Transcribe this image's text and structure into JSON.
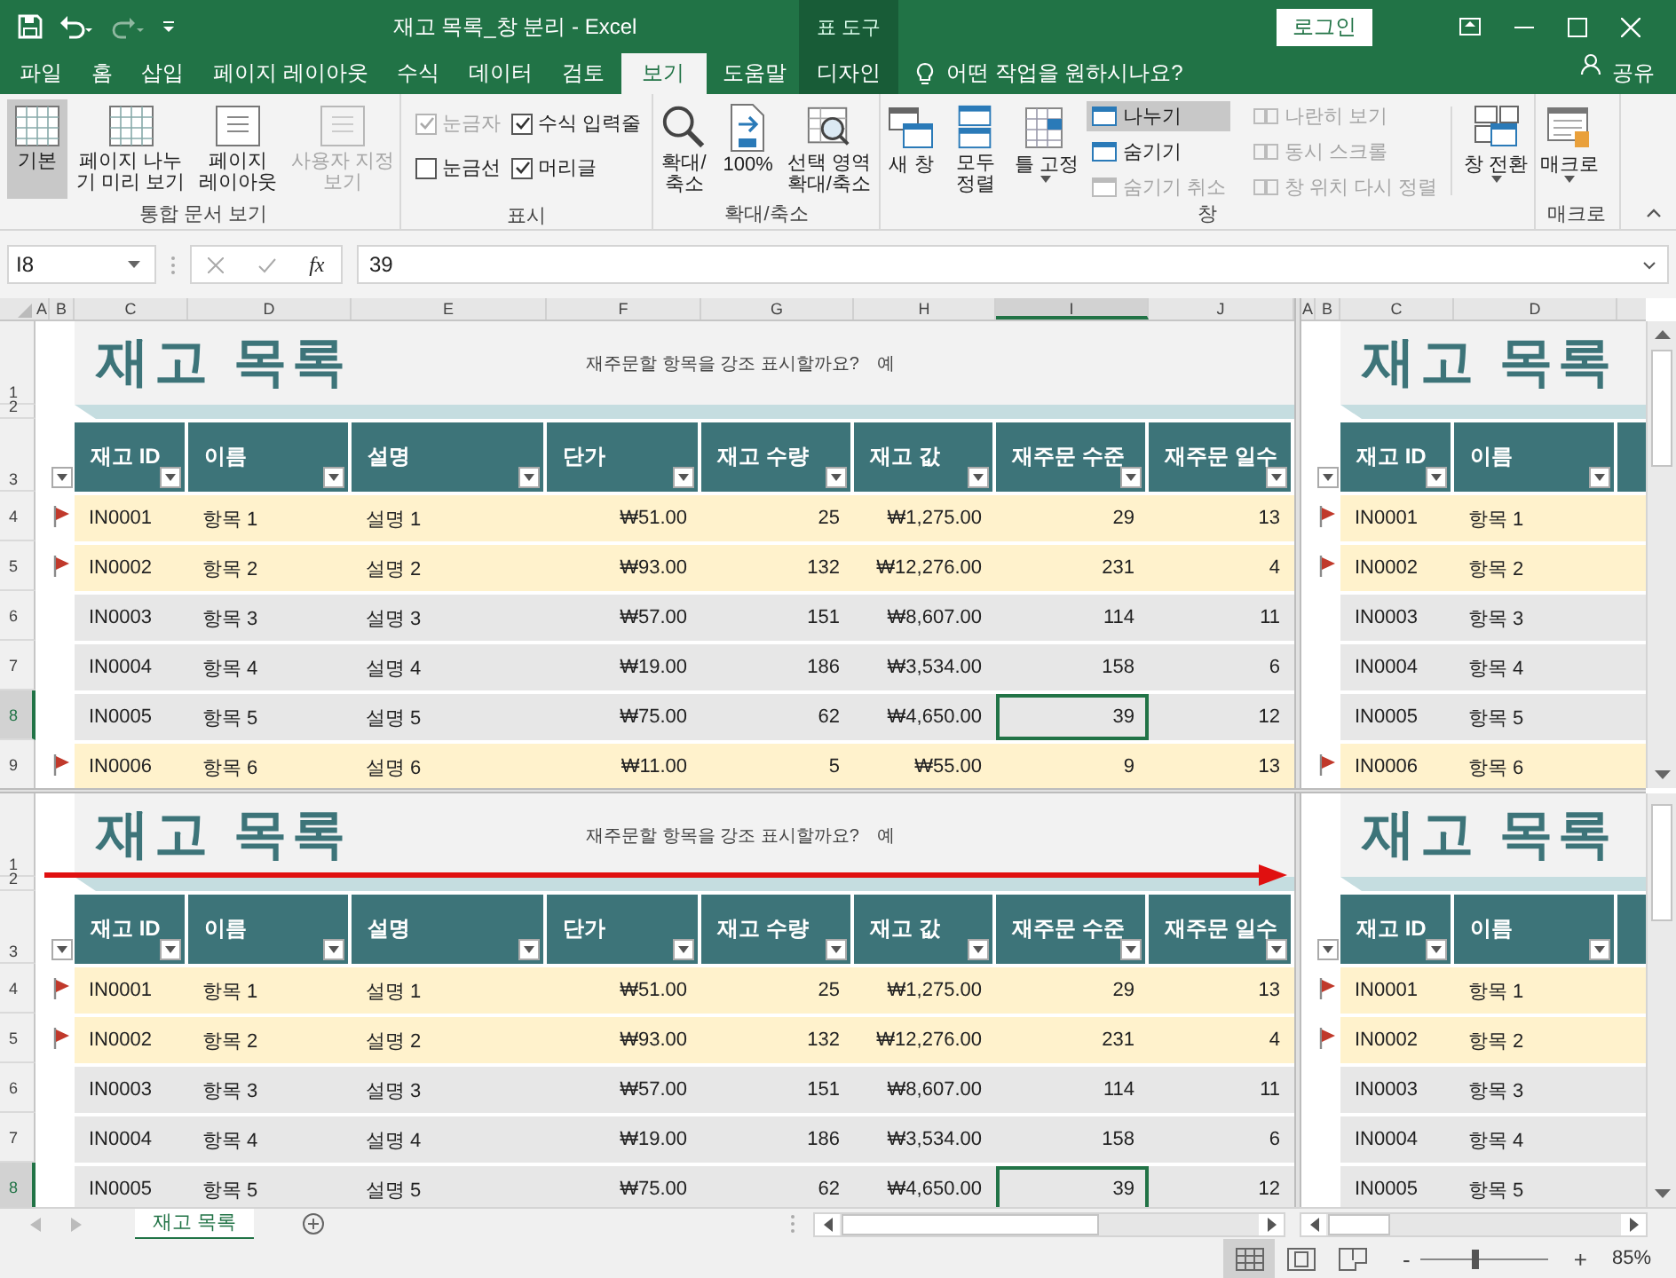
{
  "title_bar": {
    "title": "재고 목록_창 분리 - Excel",
    "context": "표 도구",
    "login": "로그인"
  },
  "tabs": [
    {
      "label": "파일",
      "selected": false
    },
    {
      "label": "홈",
      "selected": false
    },
    {
      "label": "삽입",
      "selected": false
    },
    {
      "label": "페이지 레이아웃",
      "selected": false
    },
    {
      "label": "수식",
      "selected": false
    },
    {
      "label": "데이터",
      "selected": false
    },
    {
      "label": "검토",
      "selected": false
    },
    {
      "label": "보기",
      "selected": true
    },
    {
      "label": "도움말",
      "selected": false
    }
  ],
  "context_tab": {
    "label": "디자인",
    "selected": false
  },
  "tell_me": "어떤 작업을 원하시나요?",
  "share": "공유",
  "ribbon": {
    "workbook_views": {
      "label": "통합 문서 보기",
      "buttons": [
        {
          "label": "기본",
          "selected": true,
          "disabled": false
        },
        {
          "label": "페이지 나누\n기 미리 보기",
          "selected": false,
          "disabled": false
        },
        {
          "label": "페이지\n레이아웃",
          "selected": false,
          "disabled": false
        },
        {
          "label": "사용자 지정\n보기",
          "selected": false,
          "disabled": true
        }
      ]
    },
    "show": {
      "label": "표시",
      "checkboxes": [
        {
          "label": "눈금자",
          "checked": true,
          "disabled": true
        },
        {
          "label": "수식 입력줄",
          "checked": true,
          "disabled": false
        },
        {
          "label": "눈금선",
          "checked": false,
          "disabled": false
        },
        {
          "label": "머리글",
          "checked": true,
          "disabled": false
        }
      ]
    },
    "zoom": {
      "label": "확대/축소",
      "buttons": [
        "확대/\n축소",
        "100%",
        "선택 영역\n확대/축소"
      ]
    },
    "window": {
      "label": "창",
      "large": [
        "새 창",
        "모두\n정렬",
        "틀 고정"
      ],
      "small": [
        {
          "label": "나누기",
          "selected": true,
          "disabled": false
        },
        {
          "label": "숨기기",
          "selected": false,
          "disabled": false
        },
        {
          "label": "숨기기 취소",
          "selected": false,
          "disabled": true
        },
        {
          "label": "나란히 보기",
          "selected": false,
          "disabled": true
        },
        {
          "label": "동시 스크롤",
          "selected": false,
          "disabled": true
        },
        {
          "label": "창 위치 다시 정렬",
          "selected": false,
          "disabled": true
        }
      ],
      "switch": "창 전환"
    },
    "macros": {
      "label": "매크로",
      "button": "매크로"
    }
  },
  "formula_bar": {
    "name_box": "I8",
    "function_label": "fx",
    "value": "39"
  },
  "column_headers": {
    "left": [
      {
        "label": "A",
        "selected": false
      },
      {
        "label": "B",
        "selected": false
      },
      {
        "label": "C",
        "selected": false
      },
      {
        "label": "D",
        "selected": false
      },
      {
        "label": "E",
        "selected": false
      },
      {
        "label": "F",
        "selected": false
      },
      {
        "label": "G",
        "selected": false
      },
      {
        "label": "H",
        "selected": false
      },
      {
        "label": "I",
        "selected": true
      },
      {
        "label": "J",
        "selected": false
      }
    ],
    "right": [
      {
        "label": "A",
        "selected": false
      },
      {
        "label": "B",
        "selected": false
      },
      {
        "label": "C",
        "selected": false
      },
      {
        "label": "D",
        "selected": false
      }
    ]
  },
  "panes": [
    {
      "kind": "left",
      "row_headers": [
        {
          "label": "1",
          "selected": false
        },
        {
          "label": "2",
          "selected": false
        },
        {
          "label": "3",
          "selected": false
        },
        {
          "label": "4",
          "selected": false
        },
        {
          "label": "5",
          "selected": false
        },
        {
          "label": "6",
          "selected": false
        },
        {
          "label": "7",
          "selected": false
        },
        {
          "label": "8",
          "selected": true
        },
        {
          "label": "9",
          "selected": false
        }
      ],
      "title": "재고 목록",
      "prompt": "재주문할 항목을 강조 표시할까요?",
      "answer": "예",
      "headers": [
        "재고 ID",
        "이름",
        "설명",
        "단가",
        "재고 수량",
        "재고 값",
        "재주문 수준",
        "재주문 일수"
      ],
      "rows": [
        {
          "flagged": true,
          "selected": false,
          "cells": [
            "IN0001",
            "항목 1",
            "설명 1",
            "₩51.00",
            "25",
            "₩1,275.00",
            "29",
            "13"
          ]
        },
        {
          "flagged": true,
          "selected": false,
          "cells": [
            "IN0002",
            "항목 2",
            "설명 2",
            "₩93.00",
            "132",
            "₩12,276.00",
            "231",
            "4"
          ]
        },
        {
          "flagged": false,
          "selected": false,
          "cells": [
            "IN0003",
            "항목 3",
            "설명 3",
            "₩57.00",
            "151",
            "₩8,607.00",
            "114",
            "11"
          ]
        },
        {
          "flagged": false,
          "selected": false,
          "cells": [
            "IN0004",
            "항목 4",
            "설명 4",
            "₩19.00",
            "186",
            "₩3,534.00",
            "158",
            "6"
          ]
        },
        {
          "flagged": false,
          "selected": true,
          "cells": [
            "IN0005",
            "항목 5",
            "설명 5",
            "₩75.00",
            "62",
            "₩4,650.00",
            "39",
            "12"
          ]
        },
        {
          "flagged": true,
          "selected": false,
          "cells": [
            "IN0006",
            "항목 6",
            "설명 6",
            "₩11.00",
            "5",
            "₩55.00",
            "9",
            "13"
          ]
        }
      ]
    },
    {
      "kind": "right",
      "title": "재고 목록",
      "headers": [
        "재고 ID",
        "이름"
      ],
      "rows": [
        {
          "flagged": true,
          "cells": [
            "IN0001",
            "항목 1"
          ]
        },
        {
          "flagged": true,
          "cells": [
            "IN0002",
            "항목 2"
          ]
        },
        {
          "flagged": false,
          "cells": [
            "IN0003",
            "항목 3"
          ]
        },
        {
          "flagged": false,
          "cells": [
            "IN0004",
            "항목 4"
          ]
        },
        {
          "flagged": false,
          "cells": [
            "IN0005",
            "항목 5"
          ]
        },
        {
          "flagged": true,
          "cells": [
            "IN0006",
            "항목 6"
          ]
        }
      ]
    },
    {
      "kind": "left",
      "row_headers": [
        {
          "label": "1",
          "selected": false
        },
        {
          "label": "2",
          "selected": false
        },
        {
          "label": "3",
          "selected": false
        },
        {
          "label": "4",
          "selected": false
        },
        {
          "label": "5",
          "selected": false
        },
        {
          "label": "6",
          "selected": false
        },
        {
          "label": "7",
          "selected": false
        },
        {
          "label": "8",
          "selected": true
        }
      ],
      "title": "재고 목록",
      "prompt": "재주문할 항목을 강조 표시할까요?",
      "answer": "예",
      "headers": [
        "재고 ID",
        "이름",
        "설명",
        "단가",
        "재고 수량",
        "재고 값",
        "재주문 수준",
        "재주문 일수"
      ],
      "rows": [
        {
          "flagged": true,
          "selected": false,
          "cells": [
            "IN0001",
            "항목 1",
            "설명 1",
            "₩51.00",
            "25",
            "₩1,275.00",
            "29",
            "13"
          ]
        },
        {
          "flagged": true,
          "selected": false,
          "cells": [
            "IN0002",
            "항목 2",
            "설명 2",
            "₩93.00",
            "132",
            "₩12,276.00",
            "231",
            "4"
          ]
        },
        {
          "flagged": false,
          "selected": false,
          "cells": [
            "IN0003",
            "항목 3",
            "설명 3",
            "₩57.00",
            "151",
            "₩8,607.00",
            "114",
            "11"
          ]
        },
        {
          "flagged": false,
          "selected": false,
          "cells": [
            "IN0004",
            "항목 4",
            "설명 4",
            "₩19.00",
            "186",
            "₩3,534.00",
            "158",
            "6"
          ]
        },
        {
          "flagged": false,
          "selected": true,
          "cells": [
            "IN0005",
            "항목 5",
            "설명 5",
            "₩75.00",
            "62",
            "₩4,650.00",
            "39",
            "12"
          ]
        }
      ]
    },
    {
      "kind": "right",
      "title": "재고 목록",
      "headers": [
        "재고 ID",
        "이름"
      ],
      "rows": [
        {
          "flagged": true,
          "cells": [
            "IN0001",
            "항목 1"
          ]
        },
        {
          "flagged": true,
          "cells": [
            "IN0002",
            "항목 2"
          ]
        },
        {
          "flagged": false,
          "cells": [
            "IN0003",
            "항목 3"
          ]
        },
        {
          "flagged": false,
          "cells": [
            "IN0004",
            "항목 4"
          ]
        },
        {
          "flagged": false,
          "cells": [
            "IN0005",
            "항목 5"
          ]
        }
      ]
    }
  ],
  "sheet_tabs": [
    {
      "label": "재고 목록",
      "selected": true
    }
  ],
  "status_bar": {
    "views": [
      {
        "selected": true
      },
      {
        "selected": false
      },
      {
        "selected": false
      }
    ],
    "zoom_out": "-",
    "zoom_in": "+",
    "zoom": {
      "level": 0.43,
      "reading": "85%"
    }
  }
}
